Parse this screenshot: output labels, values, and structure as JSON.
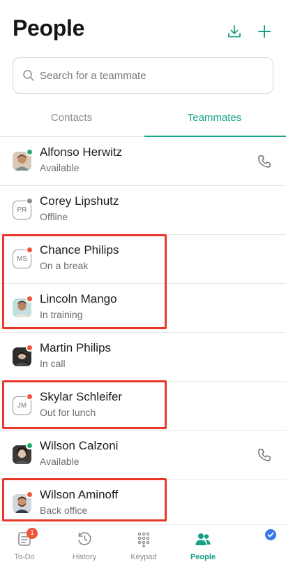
{
  "header": {
    "title": "People"
  },
  "search": {
    "placeholder": "Search for a teammate"
  },
  "tabs": [
    {
      "label": "Contacts",
      "active": false
    },
    {
      "label": "Teammates",
      "active": true
    }
  ],
  "teammates": [
    {
      "name": "Alfonso Herwitz",
      "status": "Available",
      "status_color": "#1fae6b",
      "avatar": "photo",
      "initials": "",
      "callable": true,
      "highlighted": false
    },
    {
      "name": "Corey Lipshutz",
      "status": "Offline",
      "status_color": "#8d8d8d",
      "avatar": "initials",
      "initials": "PR",
      "callable": false,
      "highlighted": false
    },
    {
      "name": "Chance Philips",
      "status": "On a break",
      "status_color": "#f0533a",
      "avatar": "initials",
      "initials": "MS",
      "callable": false,
      "highlighted": true
    },
    {
      "name": "Lincoln Mango",
      "status": "In training",
      "status_color": "#f0533a",
      "avatar": "photo",
      "initials": "",
      "callable": false,
      "highlighted": true
    },
    {
      "name": "Martin Philips",
      "status": "In call",
      "status_color": "#f0533a",
      "avatar": "photo",
      "initials": "",
      "callable": false,
      "highlighted": false
    },
    {
      "name": "Skylar Schleifer",
      "status": "Out for lunch",
      "status_color": "#f0533a",
      "avatar": "initials",
      "initials": "JM",
      "callable": false,
      "highlighted": true
    },
    {
      "name": "Wilson Calzoni",
      "status": "Available",
      "status_color": "#1fae6b",
      "avatar": "photo",
      "initials": "",
      "callable": true,
      "highlighted": false
    },
    {
      "name": "Wilson Aminoff",
      "status": "Back office",
      "status_color": "#f0533a",
      "avatar": "photo",
      "initials": "",
      "callable": false,
      "highlighted": true
    }
  ],
  "bottom_nav": [
    {
      "label": "To-Do",
      "icon": "todo-icon",
      "badge": "1",
      "active": false
    },
    {
      "label": "History",
      "icon": "history-icon",
      "badge": "",
      "active": false
    },
    {
      "label": "Keypad",
      "icon": "keypad-icon",
      "badge": "",
      "active": false
    },
    {
      "label": "People",
      "icon": "people-icon",
      "badge": "",
      "active": true
    }
  ],
  "colors": {
    "accent": "#16a085",
    "available": "#1fae6b",
    "busy": "#f0533a",
    "offline": "#8d8d8d",
    "highlight": "#e8382a"
  }
}
